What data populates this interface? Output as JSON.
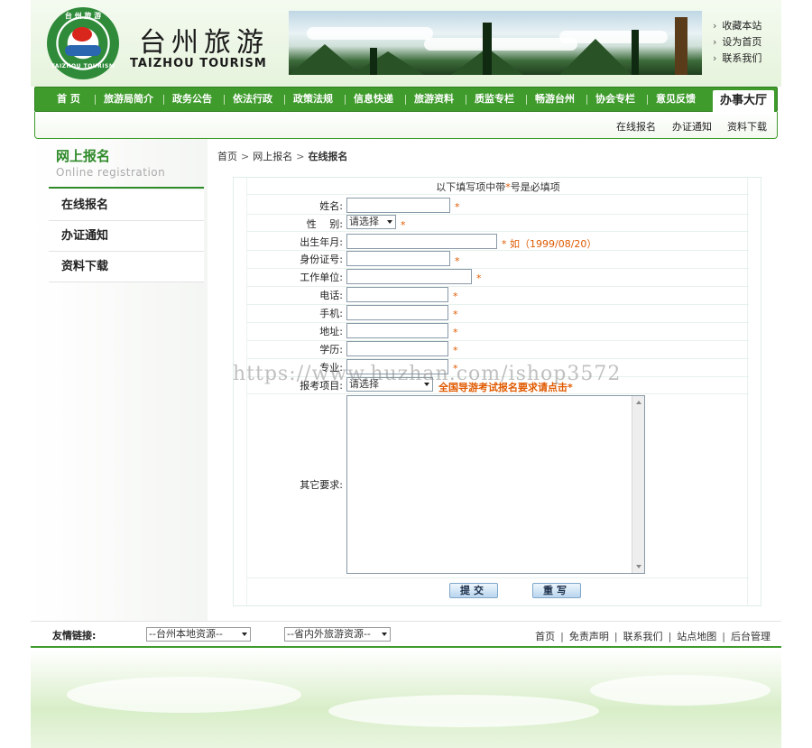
{
  "header": {
    "brand_cn": "台州旅游",
    "brand_en": "TAIZHOU TOURISM",
    "logo_ring_top": "台 州 旅 游",
    "logo_ring_bottom": "TAIZHOU TOURISM",
    "top_links": [
      "收藏本站",
      "设为首页",
      "联系我们"
    ]
  },
  "nav": {
    "items": [
      "首 页",
      "旅游局简介",
      "政务公告",
      "依法行政",
      "政策法规",
      "信息快递",
      "旅游资料",
      "质监专栏",
      "畅游台州",
      "协会专栏",
      "意见反馈"
    ],
    "active": "办事大厅"
  },
  "subnav": {
    "items": [
      "在线报名",
      "办证通知",
      "资料下载"
    ]
  },
  "sidebar": {
    "title_cn": "网上报名",
    "title_en": "Online registration",
    "items": [
      "在线报名",
      "办证通知",
      "资料下载"
    ]
  },
  "breadcrumb": {
    "items": [
      "首页",
      "网上报名",
      "在线报名"
    ],
    "sep": ">"
  },
  "form": {
    "notice_pre": "以下填写项中带",
    "notice_star": "*",
    "notice_post": "号是必填项",
    "star": "*",
    "fields": {
      "name": "姓名:",
      "gender": "性　 别:",
      "birth": "出生年月:",
      "id": "身份证号:",
      "work": "工作单位:",
      "phone": "电话:",
      "mobile": "手机:",
      "address": "地址:",
      "education": "学历:",
      "major": "专业:",
      "project": "报考项目:",
      "other": "其它要求:"
    },
    "gender_select": "请选择",
    "birth_hint": "* 如（1999/08/20）",
    "project_select": "请选择",
    "project_link": "全国导游考试报名要求请点击*",
    "submit": "提交",
    "reset": "重写"
  },
  "footer": {
    "friend_label": "友情链接:",
    "select1": "--台州本地资源--",
    "select2": "--省内外旅游资源--",
    "links": [
      "首页",
      "免责声明",
      "联系我们",
      "站点地图",
      "后台管理"
    ]
  },
  "watermark": "https://www.huzhan.com/ishop3572",
  "colors": {
    "primary_green": "#3f9b2c",
    "required_orange": "#e05a00"
  }
}
